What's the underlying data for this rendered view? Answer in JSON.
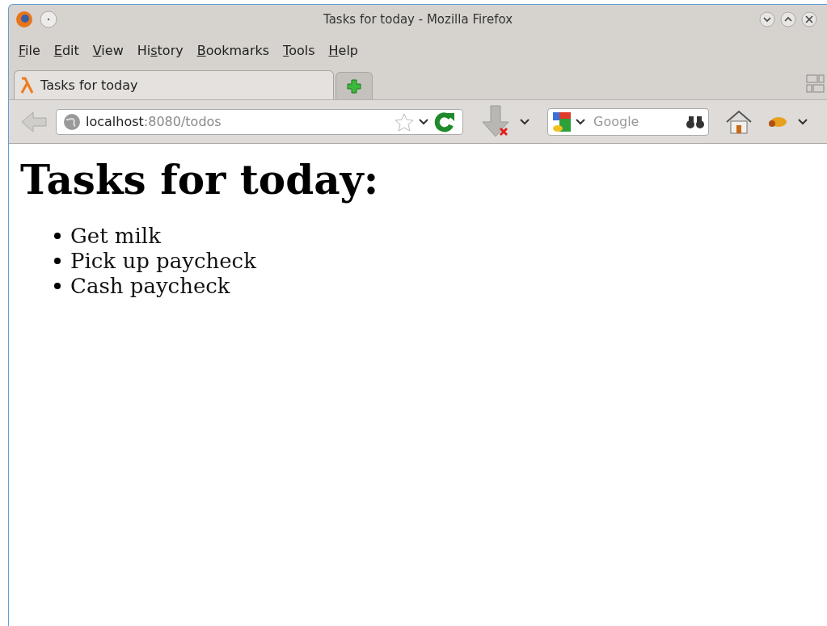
{
  "window": {
    "title": "Tasks for today - Mozilla Firefox"
  },
  "menu": [
    {
      "key": "F",
      "after": "ile"
    },
    {
      "key": "E",
      "after": "dit"
    },
    {
      "key": "V",
      "after": "iew"
    },
    {
      "before": "Hi",
      "key": "s",
      "after": "tory"
    },
    {
      "key": "B",
      "after": "ookmarks"
    },
    {
      "key": "T",
      "after": "ools"
    },
    {
      "key": "H",
      "after": "elp"
    }
  ],
  "tabs": [
    {
      "label": "Tasks for today",
      "selected": true
    }
  ],
  "address_bar": {
    "host": "localhost",
    "path": ":8080/todos"
  },
  "search": {
    "placeholder": "Google"
  },
  "page": {
    "heading": "Tasks for today:",
    "items": [
      "Get milk",
      "Pick up paycheck",
      "Cash paycheck"
    ]
  }
}
